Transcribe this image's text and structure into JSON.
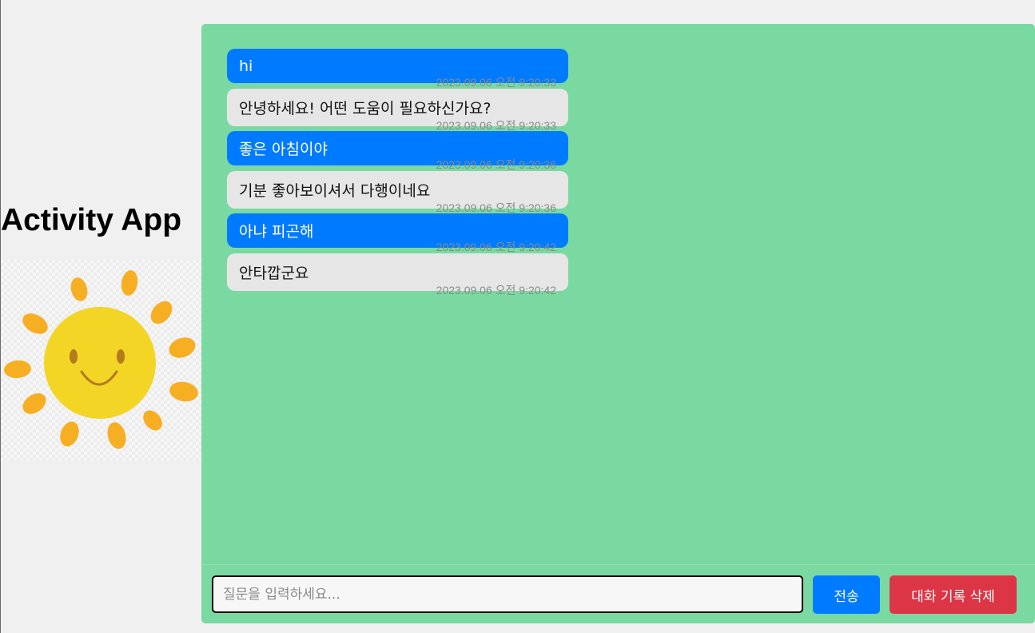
{
  "app": {
    "title": "Activity App"
  },
  "colors": {
    "page_bg": "#f0f0f0",
    "chat_bg": "#7ad9a0",
    "user_bubble": "#007bff",
    "bot_bubble": "#e6e6e6",
    "send_button": "#007bff",
    "clear_button": "#dc3545",
    "timestamp": "#8a8a8a"
  },
  "logo": {
    "icon": "smiling-sun-icon"
  },
  "messages": [
    {
      "role": "user",
      "text": "hi",
      "time": "2023.09.06 오전 9:20:33"
    },
    {
      "role": "bot",
      "text": "안녕하세요! 어떤 도움이 필요하신가요?",
      "time": "2023.09.06 오전 9:20:33"
    },
    {
      "role": "user",
      "text": "좋은 아침이야",
      "time": "2023.09.06 오전 9:20:36"
    },
    {
      "role": "bot",
      "text": "기분 좋아보이셔서 다행이네요",
      "time": "2023.09.06 오전 9:20:36"
    },
    {
      "role": "user",
      "text": "아냐 피곤해",
      "time": "2023.09.06 오전 9:20:42"
    },
    {
      "role": "bot",
      "text": "안타깝군요",
      "time": "2023.09.06 오전 9:20:42"
    }
  ],
  "composer": {
    "placeholder": "질문을 입력하세요...",
    "value": "",
    "send_label": "전송",
    "clear_label": "대화 기록 삭제"
  }
}
